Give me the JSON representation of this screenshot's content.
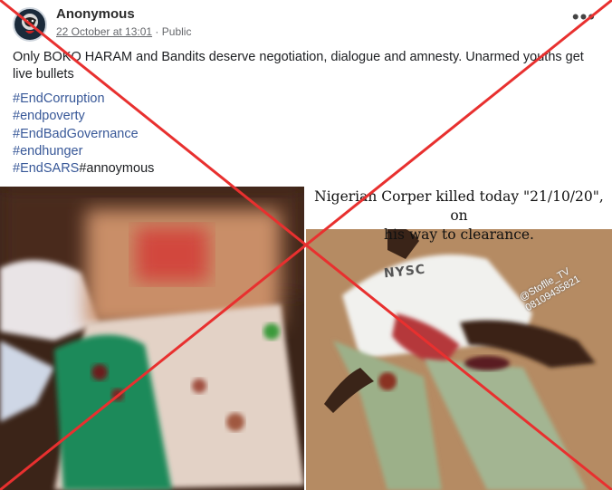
{
  "post": {
    "author": "Anonymous",
    "date": "22 October at 13:01",
    "separator": "·",
    "audience": "Public",
    "more_label": "•••",
    "text": "Only BOKO HARAM and Bandits deserve negotiation, dialogue and amnesty. Unarmed youths get live bullets",
    "hashtags": [
      "#EndCorruption",
      "#endpoverty",
      "#EndBadGovernance",
      "#endhunger"
    ],
    "last_tag": "#EndSARS",
    "last_tag_suffix": "#annoymous"
  },
  "images": {
    "right_caption_line1": "Nigerian Corper killed today \"21/10/20\", on",
    "right_caption_line2": "his way to clearance.",
    "shirt_text": "NYSC",
    "watermark_line1": "@Stoflle_TV",
    "watermark_line2": "08109435821"
  },
  "colors": {
    "link": "#385898",
    "cross": "#e8302f",
    "flag_green": "#1c8a5a"
  }
}
